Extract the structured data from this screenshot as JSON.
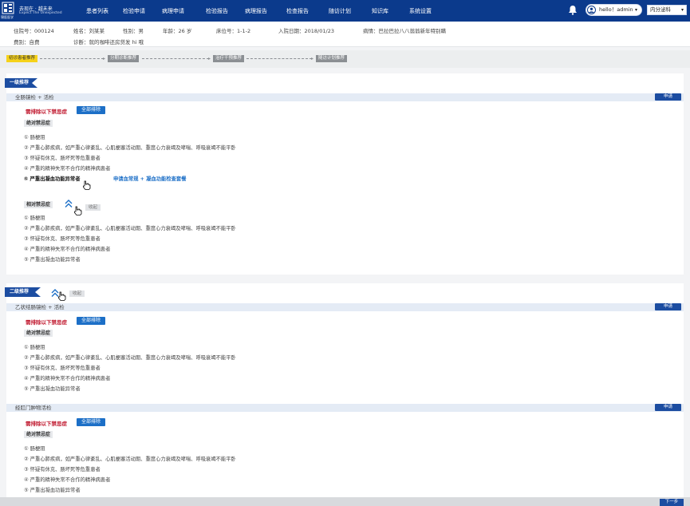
{
  "brand": {
    "logo_text": "锦医医学",
    "slogan_cn": "去现在 · 越未来",
    "slogan_en": "Expect The Unexpected"
  },
  "nav": {
    "items": [
      "患者列表",
      "检验申请",
      "病理申请",
      "检验报告",
      "病理报告",
      "检查报告",
      "随访计划",
      "知识库",
      "系统设置"
    ]
  },
  "user": {
    "greeting": "hello！admin",
    "caret": "▾",
    "department": "内分泌科",
    "dept_caret": "▾"
  },
  "patient": {
    "admission_no": "住院号：000124",
    "name": "姓名：刘某某",
    "gender": "性别：男",
    "age": "年龄：26 岁",
    "bed": "床位号：1-1-2",
    "admit_date": "入院日期：2018/01/23",
    "disease": "病情：巴拉巴拉八八翁翁新年特别瞒",
    "fee": "费别：自费",
    "diagnosis": "诊断：就的咖啡还房贷发 hi 哦"
  },
  "workflow": {
    "steps": [
      "初诊患者推荐",
      "分期诊断推荐",
      "治疗干预推荐",
      "随访计划推荐"
    ],
    "active_index": 0
  },
  "level1": {
    "label": "一级推荐",
    "section_title": "全肠镜检 + 活检",
    "apply_label": "申请",
    "exclude_title": "需排除以下禁忌症",
    "exclude_all_label": "全部排除",
    "absolute_tag": "绝对禁忌症",
    "absolute_items": [
      "① 肠梗阻",
      "② 严重心肺疾病，如严重心律紊乱、心肌梗塞活动期、重度心力衰竭及哮喘、呼吸衰竭不能平卧",
      "③ 怀疑有休克、肠坏死等危重患者",
      "④ 严重的精神失常不合作的精神病患者",
      "⑤ 严重出凝血功能异常者"
    ],
    "absolute_item5_link": "申请血常规 + 凝血功能检查套餐",
    "relative_tag": "相对禁忌症",
    "relative_collapse": "收起",
    "relative_items": [
      "① 肠梗阻",
      "② 严重心肺疾病，如严重心律紊乱、心肌梗塞活动期、重度心力衰竭及哮喘、呼吸衰竭不能平卧",
      "③ 怀疑有休克、肠坏死等危重患者",
      "④ 严重的精神失常不合作的精神病患者",
      "⑤ 严重出凝血功能异常者"
    ]
  },
  "level2": {
    "label": "二级推荐",
    "collapse_label": "收起",
    "sections": [
      {
        "title": "乙状结肠镜检 + 活检",
        "apply_label": "申请",
        "exclude_title": "需排除以下禁忌症",
        "exclude_all_label": "全部排除",
        "absolute_tag": "绝对禁忌症",
        "items": [
          "① 肠梗阻",
          "② 严重心肺疾病，如严重心律紊乱、心肌梗塞活动期、重度心力衰竭及哮喘、呼吸衰竭不能平卧",
          "③ 怀疑有休克、肠坏死等危重患者",
          "④ 严重的精神失常不合作的精神病患者",
          "⑤ 严重出凝血功能异常者"
        ]
      },
      {
        "title": "经肛门肿物活检",
        "apply_label": "申请",
        "exclude_title": "需排除以下禁忌症",
        "exclude_all_label": "全部排除",
        "absolute_tag": "绝对禁忌症",
        "items": [
          "① 肠梗阻",
          "② 严重心肺疾病，如严重心律紊乱、心肌梗塞活动期、重度心力衰竭及哮喘、呼吸衰竭不能平卧",
          "③ 怀疑有休克、肠坏死等危重患者",
          "④ 严重的精神失常不合作的精神病患者",
          "⑤ 严重出凝血功能异常者"
        ]
      }
    ]
  },
  "footer": {
    "next_label": "下一步"
  },
  "colors": {
    "nav_bg": "#0b3a8c",
    "ribbon": "#1c4da1",
    "danger": "#c0182e",
    "link": "#1c6fc7",
    "step_active": "#f6d21a"
  },
  "icons": [
    "logo-icon",
    "bell-icon",
    "avatar-icon",
    "chevron-up-icon",
    "hand-cursor-icon"
  ]
}
